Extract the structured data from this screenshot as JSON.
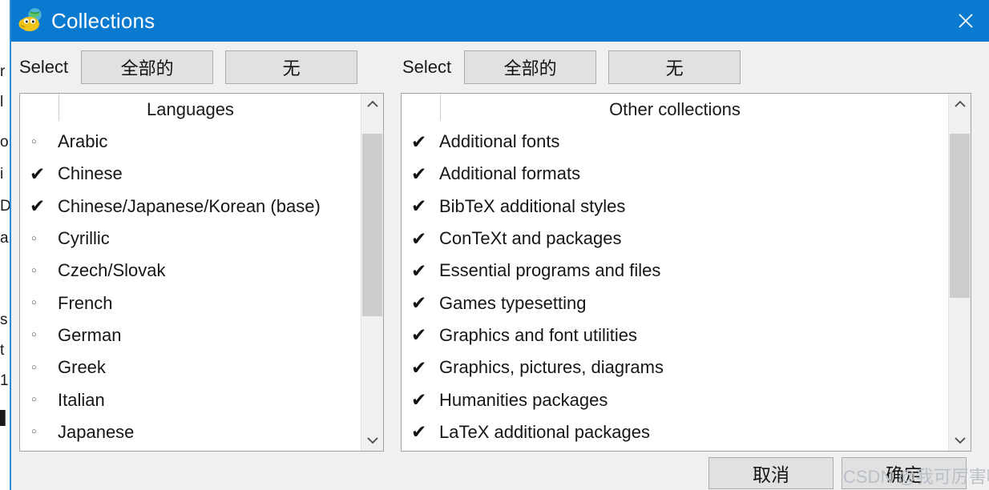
{
  "window": {
    "title": "Collections",
    "icon": "texlive-frog-icon",
    "close_label": "✕",
    "titlebar_color": "#0a79d0"
  },
  "toolbars": {
    "left": {
      "select_label": "Select",
      "all_label": "全部的",
      "none_label": "无"
    },
    "right": {
      "select_label": "Select",
      "all_label": "全部的",
      "none_label": "无"
    }
  },
  "marks": {
    "checked": "✔",
    "unchecked": "○"
  },
  "panes": {
    "left": {
      "header": "Languages",
      "items": [
        {
          "label": "Arabic",
          "checked": false
        },
        {
          "label": "Chinese",
          "checked": true
        },
        {
          "label": "Chinese/Japanese/Korean (base)",
          "checked": true
        },
        {
          "label": "Cyrillic",
          "checked": false
        },
        {
          "label": "Czech/Slovak",
          "checked": false
        },
        {
          "label": "French",
          "checked": false
        },
        {
          "label": "German",
          "checked": false
        },
        {
          "label": "Greek",
          "checked": false
        },
        {
          "label": "Italian",
          "checked": false
        },
        {
          "label": "Japanese",
          "checked": false
        }
      ],
      "scrollbar": {
        "up": "˄",
        "down": "˅",
        "thumb_top_pct": 6,
        "thumb_height_pct": 58
      }
    },
    "right": {
      "header": "Other collections",
      "items": [
        {
          "label": "Additional fonts",
          "checked": true
        },
        {
          "label": "Additional formats",
          "checked": true
        },
        {
          "label": "BibTeX additional styles",
          "checked": true
        },
        {
          "label": "ConTeXt and packages",
          "checked": true
        },
        {
          "label": "Essential programs and files",
          "checked": true
        },
        {
          "label": "Games typesetting",
          "checked": true
        },
        {
          "label": "Graphics and font utilities",
          "checked": true
        },
        {
          "label": "Graphics, pictures, diagrams",
          "checked": true
        },
        {
          "label": "Humanities packages",
          "checked": true
        },
        {
          "label": "LaTeX additional packages",
          "checked": true
        }
      ],
      "scrollbar": {
        "up": "˄",
        "down": "˅",
        "thumb_top_pct": 6,
        "thumb_height_pct": 52
      }
    }
  },
  "footer": {
    "cancel_label": "取消",
    "ok_label": "确定"
  },
  "watermark": {
    "text": "CSDN @我可厉害啦！"
  },
  "background_window": {
    "fragments": [
      "r",
      "l",
      "o",
      "i",
      "D",
      "a",
      "s",
      "t",
      "1",
      "▌"
    ]
  }
}
